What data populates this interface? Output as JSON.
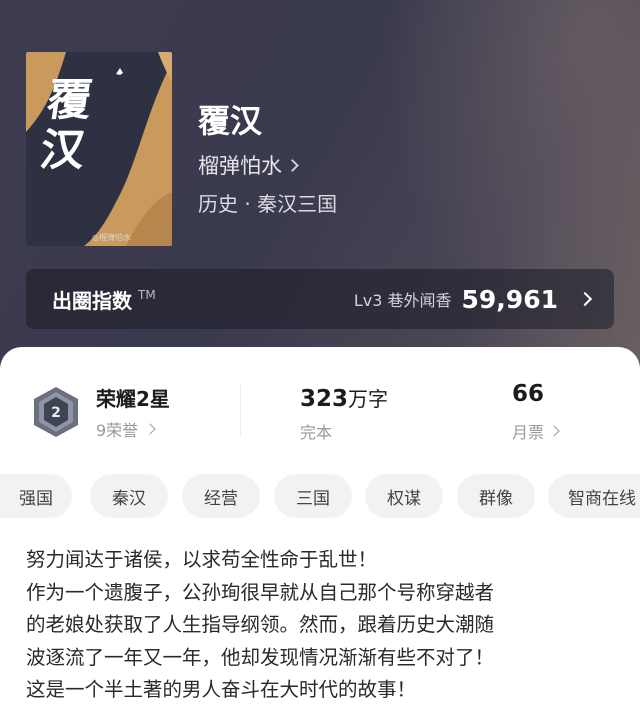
{
  "book": {
    "cover_title": "覆汉",
    "cover_author": "◎榴弹怕水",
    "title": "覆汉",
    "author": "榴弹怕水",
    "genre": "历史 · 秦汉三国"
  },
  "index": {
    "label": "出圈指数",
    "tm": "TM",
    "level": "Lv3 巷外闻香",
    "value": "59,961"
  },
  "stats": {
    "honor_title": "荣耀2星",
    "honor_sub": "9荣誉",
    "badge_number": "2",
    "words_number": "323",
    "words_unit": "万字",
    "status": "完本",
    "monthly_tickets": "66",
    "monthly_label": "月票"
  },
  "tags": [
    "强国",
    "秦汉",
    "经营",
    "三国",
    "权谋",
    "群像",
    "智商在线"
  ],
  "description": [
    "努力闻达于诸侯，以求苟全性命于乱世！",
    "作为一个遗腹子，公孙珣很早就从自己那个号称穿越者",
    "的老娘处获取了人生指导纲领。然而，跟着历史大潮随",
    "波逐流了一年又一年，他却发现情况渐渐有些不对了！",
    "这是一个半土著的男人奋斗在大时代的故事！"
  ],
  "colors": {
    "header_bg": "#3d3b50",
    "cover_gold": "#c99a5c",
    "cover_dark": "#2e3142",
    "tag_bg": "#f2f2f4"
  }
}
